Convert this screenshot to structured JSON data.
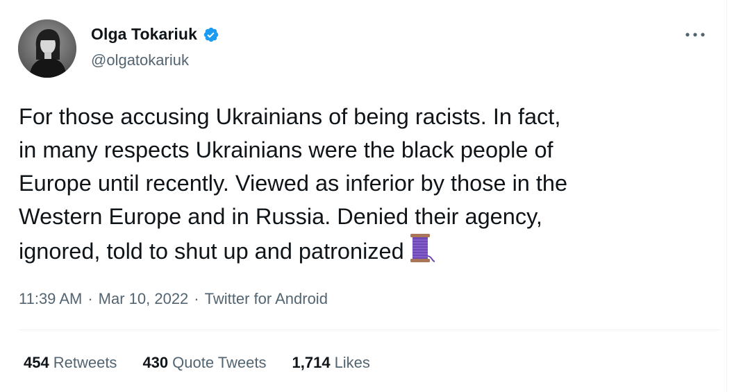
{
  "author": {
    "display_name": "Olga Tokariuk",
    "handle": "@olgatokariuk",
    "verified": true,
    "avatar_icon": "profile-photo-avatar"
  },
  "menu": {
    "more_icon": "ellipsis-horizontal-icon"
  },
  "tweet": {
    "lines": [
      "For those accusing Ukrainians of being racists. In fact,",
      "in many respects Ukrainians were the black people of",
      "Europe until recently. Viewed as inferior by those in the",
      "Western Europe and in Russia. Denied their agency,",
      "ignored, told to shut up and patronized"
    ],
    "trailing_emoji": "spool-of-thread-icon"
  },
  "meta": {
    "time": "11:39 AM",
    "separator": "·",
    "date": "Mar 10, 2022",
    "source": "Twitter for Android"
  },
  "stats": {
    "retweets_count": "454",
    "retweets_label": "Retweets",
    "quote_count": "430",
    "quote_label": "Quote Tweets",
    "likes_count": "1,714",
    "likes_label": "Likes"
  },
  "colors": {
    "text_primary": "#0f1419",
    "text_secondary": "#536471",
    "verified_blue": "#1d9bf0",
    "divider": "#eff3f4"
  }
}
